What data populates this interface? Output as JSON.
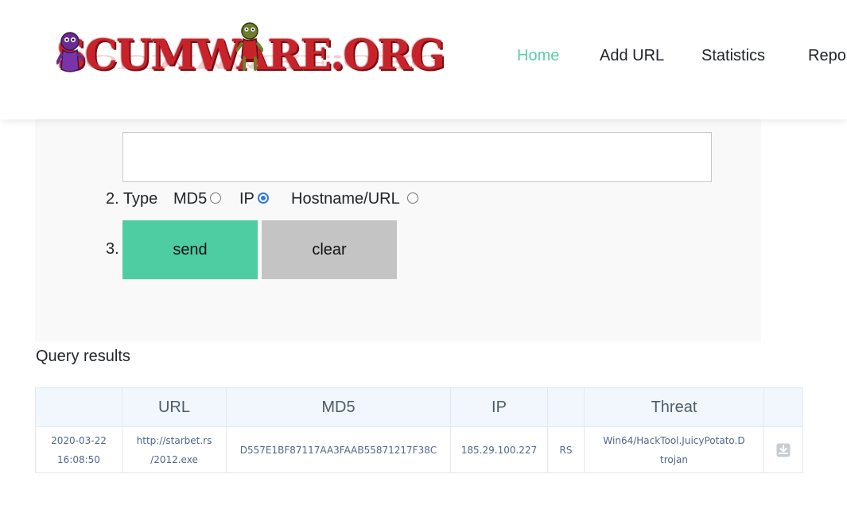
{
  "header": {
    "logo_text": "SCUMWARE.ORG",
    "nav": [
      {
        "label": "Home",
        "active": true
      },
      {
        "label": "Add URL",
        "active": false
      },
      {
        "label": "Statistics",
        "active": false
      },
      {
        "label": "Repor",
        "active": false
      }
    ],
    "accent_color": "#5ccfa7"
  },
  "form": {
    "query_value": "",
    "type_step": "2. Type",
    "types": [
      {
        "label": "MD5",
        "checked": false
      },
      {
        "label": "IP",
        "checked": true
      },
      {
        "label": "Hostname/URL",
        "checked": false
      }
    ],
    "action_step": "3.",
    "send_label": "send",
    "clear_label": "clear",
    "send_color": "#4fcda2",
    "clear_color": "#c4c4c4"
  },
  "results": {
    "title": "Query results",
    "columns": [
      "",
      "URL",
      "MD5",
      "IP",
      "",
      "Threat",
      ""
    ],
    "rows": [
      {
        "date": "2020-03-22",
        "time": "16:08:50",
        "url_line1": "http://starbet.rs",
        "url_line2": "/2012.exe",
        "md5": "D557E1BF87117AA3FAAB55871217F38C",
        "ip": "185.29.100.227",
        "country": "RS",
        "threat_line1": "Win64/HackTool.JuicyPotato.D",
        "threat_line2": "trojan",
        "action_icon": "download-icon"
      }
    ]
  }
}
